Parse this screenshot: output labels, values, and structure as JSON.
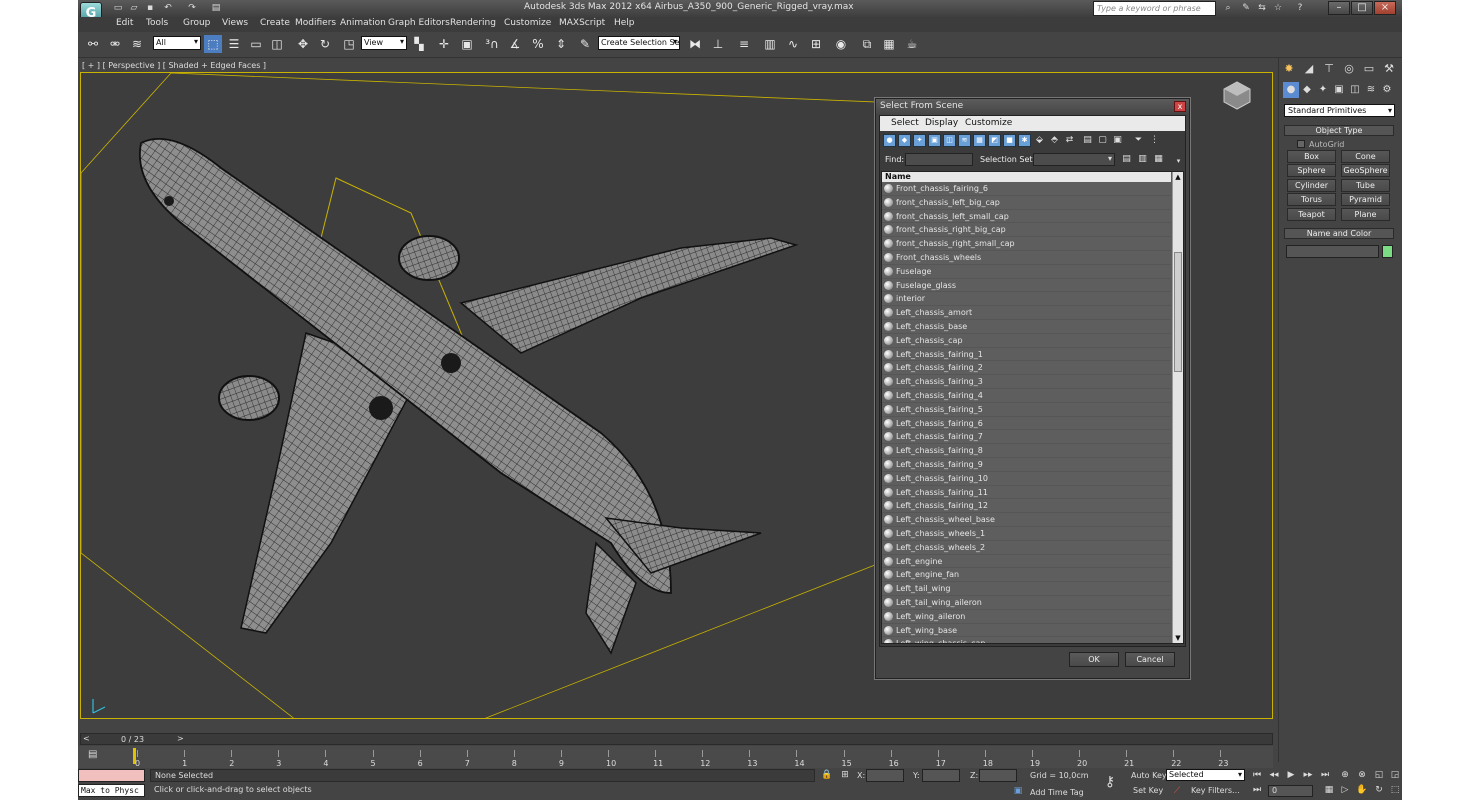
{
  "window": {
    "title": "Autodesk 3ds Max  2012 x64      Airbus_A350_900_Generic_Rigged_vray.max",
    "search_placeholder": "Type a keyword or phrase",
    "logo": "G"
  },
  "menu": [
    "Edit",
    "Tools",
    "Group",
    "Views",
    "Create",
    "Modifiers",
    "Animation",
    "Graph Editors",
    "Rendering",
    "Customize",
    "MAXScript",
    "Help"
  ],
  "toolbar": {
    "filter_value": "All",
    "refcoord_value": "View",
    "selection_set_value": "Create Selection Se"
  },
  "viewport": {
    "label": "[ + ] [ Perspective ] [ Shaded + Edged Faces ]"
  },
  "dialog": {
    "title": "Select From Scene",
    "close": "x",
    "menu": [
      "Select",
      "Display",
      "Customize"
    ],
    "find_label": "Find:",
    "selection_set_label": "Selection Set:",
    "column_name": "Name",
    "items": [
      "Front_chassis_fairing_6",
      "front_chassis_left_big_cap",
      "front_chassis_left_small_cap",
      "front_chassis_right_big_cap",
      "front_chassis_right_small_cap",
      "Front_chassis_wheels",
      "Fuselage",
      "Fuselage_glass",
      "interior",
      "Left_chassis_amort",
      "Left_chassis_base",
      "Left_chassis_cap",
      "Left_chassis_fairing_1",
      "Left_chassis_fairing_2",
      "Left_chassis_fairing_3",
      "Left_chassis_fairing_4",
      "Left_chassis_fairing_5",
      "Left_chassis_fairing_6",
      "Left_chassis_fairing_7",
      "Left_chassis_fairing_8",
      "Left_chassis_fairing_9",
      "Left_chassis_fairing_10",
      "Left_chassis_fairing_11",
      "Left_chassis_fairing_12",
      "Left_chassis_wheel_base",
      "Left_chassis_wheels_1",
      "Left_chassis_wheels_2",
      "Left_engine",
      "Left_engine_fan",
      "Left_tail_wing",
      "Left_tail_wing_aileron",
      "Left_wing_aileron",
      "Left_wing_base",
      "Left_wing_chassis_cap"
    ],
    "ok": "OK",
    "cancel": "Cancel"
  },
  "command_panel": {
    "dropdown": "Standard Primitives",
    "object_type_title": "Object Type",
    "autogrid": "AutoGrid",
    "buttons": [
      "Box",
      "Cone",
      "Sphere",
      "GeoSphere",
      "Cylinder",
      "Tube",
      "Torus",
      "Pyramid",
      "Teapot",
      "Plane"
    ],
    "name_color_title": "Name and Color",
    "swatch_color": "#7bdc83"
  },
  "timeline": {
    "frame_label": "0 / 23",
    "ticks": [
      "0",
      "1",
      "2",
      "3",
      "4",
      "5",
      "6",
      "7",
      "8",
      "9",
      "10",
      "11",
      "12",
      "13",
      "14",
      "15",
      "16",
      "17",
      "18",
      "19",
      "20",
      "21",
      "22",
      "23"
    ]
  },
  "status": {
    "maxscript": "Max to Physc",
    "selection": "None Selected",
    "prompt": "Click or click-and-drag to select objects",
    "x_label": "X:",
    "y_label": "Y:",
    "z_label": "Z:",
    "grid": "Grid = 10,0cm",
    "add_time_tag": "Add Time Tag",
    "auto_key": "Auto Key",
    "set_key": "Set Key",
    "key_mode": "Selected",
    "key_filters": "Key Filters...",
    "frame": "0"
  }
}
